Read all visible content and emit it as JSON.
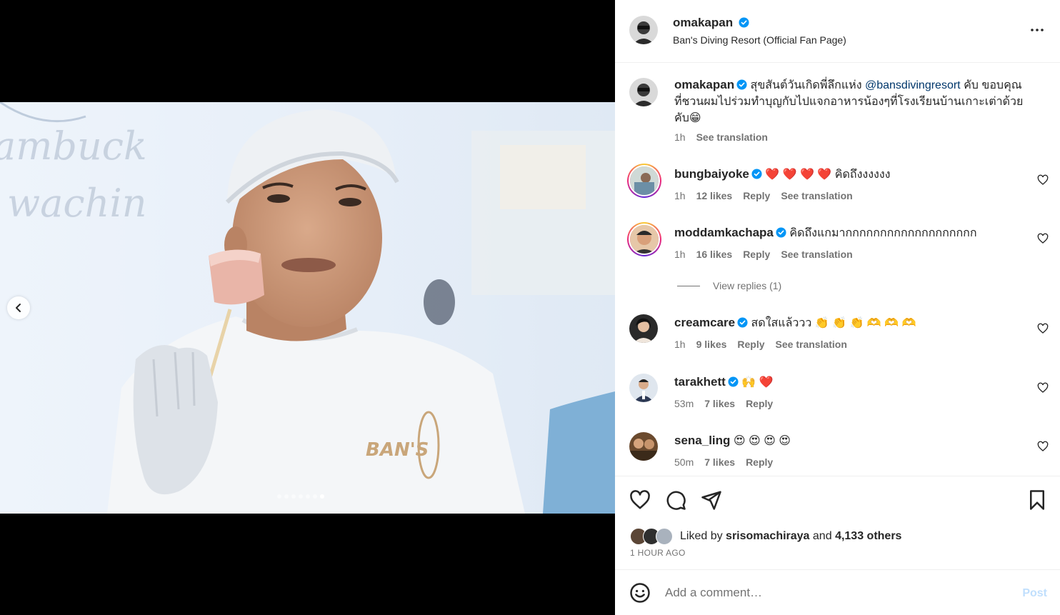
{
  "post": {
    "author": "omakapan",
    "location": "Ban's Diving Resort (Official Fan Page)",
    "carousel": {
      "total": 7,
      "current": 7
    }
  },
  "caption": {
    "user": "omakapan",
    "text_before": "สุขสันต์วันเกิดพี่ลึกแห่ง",
    "mention": "@bansdivingresort",
    "text_after": "คับ ขอบคุณที่ชวนผมไปร่วมทำบุญกับไปแจกอาหารน้องๆที่โรงเรียนบ้านเกาะเต่าด้วยคับ😁",
    "time": "1h",
    "translate": "See translation"
  },
  "comments": [
    {
      "user": "bungbaiyoke",
      "text": "❤️ ❤️ ❤️ ❤️  คิดถึงงงงงง",
      "time": "1h",
      "likes": "12 likes",
      "reply": "Reply",
      "translate": "See translation"
    },
    {
      "user": "moddamkachapa",
      "text": "คิดถึงแกมากกกกกกกกกกกกกกกกกกก",
      "time": "1h",
      "likes": "16 likes",
      "reply": "Reply",
      "translate": "See translation"
    },
    {
      "user": "creamcare",
      "text": "สดใสแล้ววว 👏 👏 👏 🫶 🫶 🫶",
      "time": "1h",
      "likes": "9 likes",
      "reply": "Reply",
      "translate": "See translation"
    },
    {
      "user": "tarakhett",
      "text": "🙌 ❤️",
      "time": "53m",
      "likes": "7 likes",
      "reply": "Reply"
    },
    {
      "user": "sena_ling",
      "text": "😍 😍 😍 😍",
      "time": "50m",
      "likes": "7 likes",
      "reply": "Reply"
    }
  ],
  "view_replies": "View replies (1)",
  "likes": {
    "prefix": "Liked by",
    "user": "srisomachiraya",
    "and": "and",
    "others": "4,133 others"
  },
  "posted_ago": "1 HOUR AGO",
  "add_comment": {
    "placeholder": "Add a comment…",
    "post_label": "Post"
  },
  "colors": {
    "verified": "#0095f6",
    "heart_red": "#ed4956",
    "link": "#00376b"
  }
}
